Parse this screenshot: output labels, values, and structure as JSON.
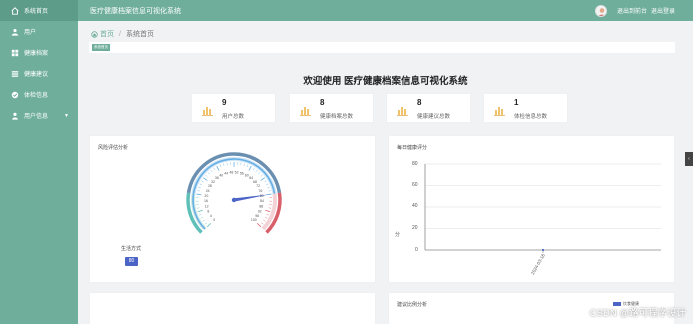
{
  "header": {
    "site_title": "医疗健康档案信息可视化系统",
    "link_frontend": "退出到前台",
    "link_logout": "退出登录"
  },
  "sidebar": {
    "items": [
      {
        "label": "系统首页",
        "icon": "home-icon"
      },
      {
        "label": "用户",
        "icon": "user-icon"
      },
      {
        "label": "健康档案",
        "icon": "grid-icon"
      },
      {
        "label": "健康建议",
        "icon": "list-icon"
      },
      {
        "label": "体检信息",
        "icon": "check-icon"
      },
      {
        "label": "用户信息",
        "icon": "person-icon"
      }
    ]
  },
  "breadcrumb": {
    "home": "首页",
    "current": "系统首页"
  },
  "tag": {
    "label": "系统首页"
  },
  "welcome": "欢迎使用 医疗健康档案信息可视化系统",
  "stats": [
    {
      "value": "9",
      "label": "用户总数"
    },
    {
      "value": "8",
      "label": "健康档案总数"
    },
    {
      "value": "8",
      "label": "健康建议总数"
    },
    {
      "value": "1",
      "label": "体检信息总数"
    }
  ],
  "gauge": {
    "title": "风险评估分析",
    "name": "生活方式",
    "value": "80",
    "value_num": 80,
    "min": 0,
    "max": 100
  },
  "daily": {
    "title": "每日健康评分",
    "y_ticks": [
      "80",
      "60",
      "40",
      "20",
      "0"
    ],
    "ylabel": "分",
    "ylim": [
      0,
      80
    ],
    "x_label": "2024-03-16",
    "value": 0
  },
  "advice": {
    "title": "建议比例分析",
    "legend_text": "饮食健康"
  },
  "watermark": "CSDN @路可程序设计",
  "colors": {
    "brand": "#6fae9b",
    "badge": "#4c64c6",
    "gauge_red": "#d9606a",
    "gauge_blue": "#64aee4",
    "gauge_teal": "#5ec0b8"
  }
}
